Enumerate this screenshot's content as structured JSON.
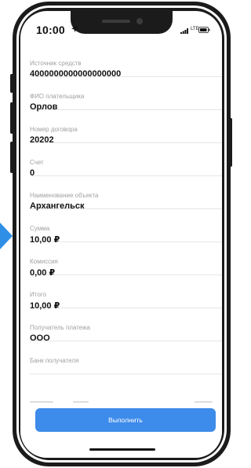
{
  "status_bar": {
    "time": "10:00",
    "network": "LTE"
  },
  "fields": [
    {
      "label": "Источник средств",
      "value": "4000000000000000000"
    },
    {
      "label": "ФИО плательщика",
      "value": "Орлов"
    },
    {
      "label": "Номер договора",
      "value": "20202"
    },
    {
      "label": "Счет",
      "value": "0"
    },
    {
      "label": "Наименование объекта",
      "value": "Архангельск"
    },
    {
      "label": "Сумма",
      "value": "10,00 ₽"
    },
    {
      "label": "Комиссия",
      "value": "0,00 ₽"
    },
    {
      "label": "Итого",
      "value": "10,00 ₽"
    },
    {
      "label": "Получатель платежа",
      "value": "ООО"
    },
    {
      "label": "Банк получателя",
      "value": ""
    }
  ],
  "actions": {
    "submit_label": "Выполнить"
  },
  "colors": {
    "accent": "#3d8bea",
    "arrow": "#2f8fe6",
    "frame": "#1b1b1b"
  }
}
